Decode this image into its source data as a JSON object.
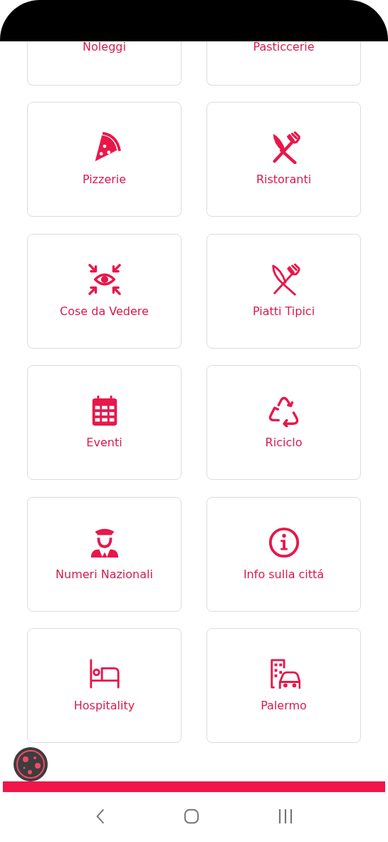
{
  "categories": [
    {
      "label": "Noleggi",
      "kind": "cut"
    },
    {
      "label": "Pasticcerie",
      "kind": "cut"
    },
    {
      "label": "Pizzerie",
      "kind": "pizza"
    },
    {
      "label": "Ristoranti",
      "kind": "cutlery"
    },
    {
      "label": "Cose da Vedere",
      "kind": "eye"
    },
    {
      "label": "Piatti Tipici",
      "kind": "utensils"
    },
    {
      "label": "Eventi",
      "kind": "calendar"
    },
    {
      "label": "Riciclo",
      "kind": "recycle"
    },
    {
      "label": "Numeri Nazionali",
      "kind": "officer"
    },
    {
      "label": "Info sulla cittá",
      "kind": "info"
    },
    {
      "label": "Hospitality",
      "kind": "bed"
    },
    {
      "label": "Palermo",
      "kind": "city"
    }
  ]
}
